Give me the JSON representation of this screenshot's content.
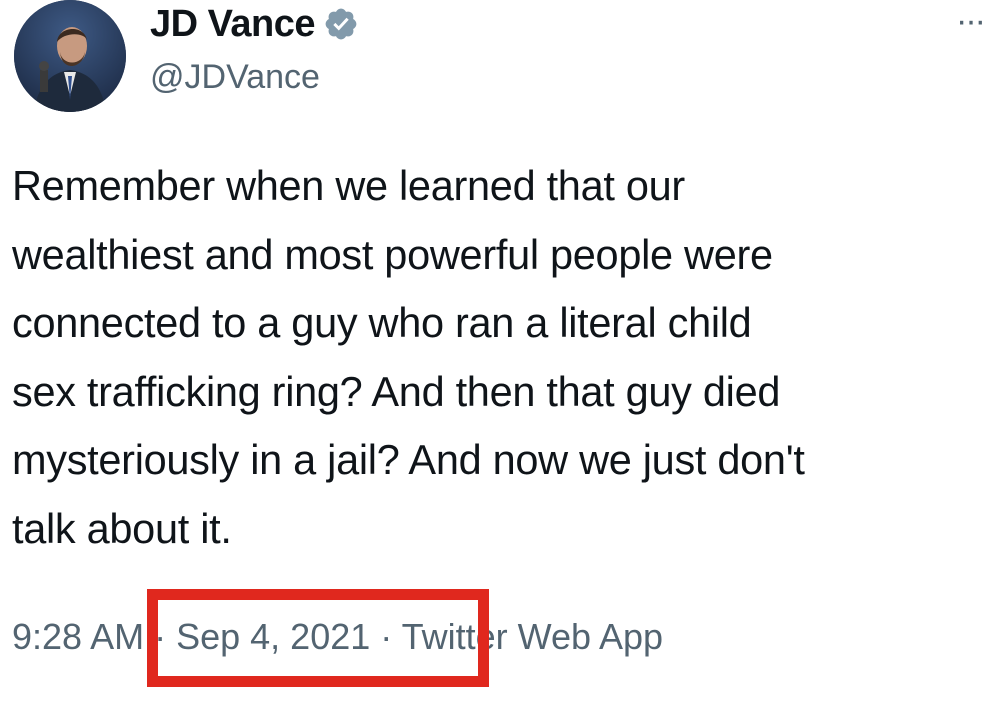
{
  "tweet": {
    "display_name": "JD Vance",
    "handle": "@JDVance",
    "verified": true,
    "more_label": "···",
    "body": "Remember when we learned that our\nwealthiest and most powerful people were\nconnected to a guy who ran a literal child\nsex trafficking ring? And then that guy died\nmysteriously in a jail? And now we just don't\ntalk about it.",
    "time": "9:28 AM",
    "separator": " · ",
    "date": "Sep 4, 2021",
    "source": "Twitter Web App"
  },
  "colors": {
    "text": "#0f1419",
    "secondary": "#536471",
    "verified_badge": "#829aab",
    "highlight": "#e0281e"
  },
  "icons": {
    "verified": "verified-badge-icon",
    "more": "more-options-icon"
  }
}
